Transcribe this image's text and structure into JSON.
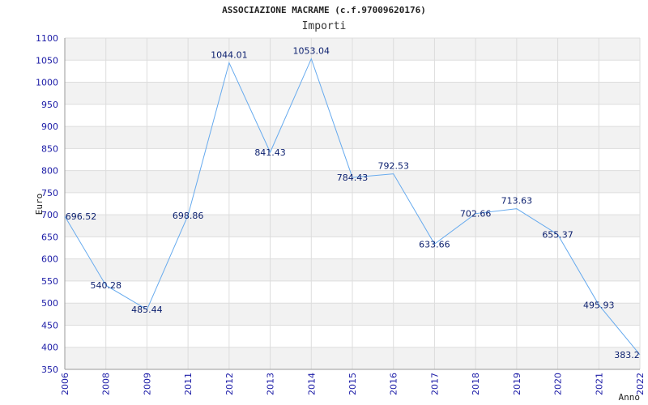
{
  "chart_data": {
    "type": "line",
    "title": "ASSOCIAZIONE MACRAME (c.f.97009620176)",
    "subtitle": "Importi",
    "xlabel": "Anno",
    "ylabel": "Euro",
    "categories": [
      "2006",
      "2008",
      "2009",
      "2011",
      "2012",
      "2013",
      "2014",
      "2015",
      "2016",
      "2017",
      "2018",
      "2019",
      "2020",
      "2021",
      "2022"
    ],
    "series": [
      {
        "values": [
          696.52,
          540.28,
          485.44,
          698.86,
          1044.01,
          841.43,
          1053.04,
          784.43,
          792.53,
          633.66,
          702.66,
          713.63,
          655.37,
          495.93,
          383.2
        ],
        "labels": [
          "696.52",
          "540.28",
          "485.44",
          "698.86",
          "1044.01",
          "841.43",
          "1053.04",
          "784.43",
          "792.53",
          "633.66",
          "702.66",
          "713.63",
          "655.37",
          "495.93",
          "383.2"
        ]
      }
    ],
    "ylim": [
      350,
      1100
    ],
    "yticks": [
      350,
      400,
      450,
      500,
      550,
      600,
      650,
      700,
      750,
      800,
      850,
      900,
      950,
      1000,
      1050,
      1100
    ],
    "grid": true,
    "legend": "none",
    "colors": {
      "line": "#66aaee",
      "band": "#f2f2f2",
      "gridline": "#dddddd",
      "axis": "#999999",
      "tick_text": "#1a1aa6",
      "label_text": "#0b1f6e"
    }
  }
}
